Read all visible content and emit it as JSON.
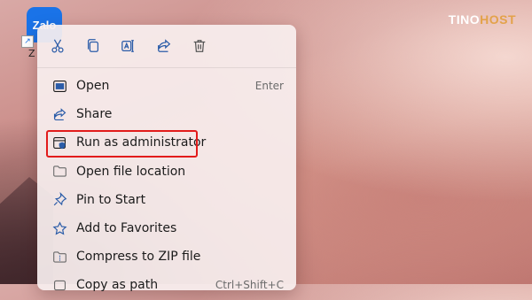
{
  "desktop": {
    "icon_text": "Zalo",
    "label": "Z"
  },
  "watermark": {
    "text_main": "TINO",
    "text_accent": "HOST"
  },
  "context_menu": {
    "toolbar": [
      {
        "name": "cut",
        "icon": "scissors-icon"
      },
      {
        "name": "copy",
        "icon": "copy-icon"
      },
      {
        "name": "rename",
        "icon": "rename-icon"
      },
      {
        "name": "share",
        "icon": "share-icon"
      },
      {
        "name": "delete",
        "icon": "trash-icon"
      }
    ],
    "items": [
      {
        "label": "Open",
        "shortcut": "Enter",
        "icon": "open-window-icon"
      },
      {
        "label": "Share",
        "shortcut": "",
        "icon": "share-icon"
      },
      {
        "label": "Run as administrator",
        "shortcut": "",
        "icon": "shield-window-icon"
      },
      {
        "label": "Open file location",
        "shortcut": "",
        "icon": "folder-icon"
      },
      {
        "label": "Pin to Start",
        "shortcut": "",
        "icon": "pin-icon"
      },
      {
        "label": "Add to Favorites",
        "shortcut": "",
        "icon": "star-icon"
      },
      {
        "label": "Compress to ZIP file",
        "shortcut": "",
        "icon": "zip-folder-icon"
      },
      {
        "label": "Copy as path",
        "shortcut": "Ctrl+Shift+C",
        "icon": "copy-path-icon"
      }
    ]
  },
  "colors": {
    "accent_icon": "#2b5ca8",
    "highlight_border": "#e21b1b",
    "watermark_accent": "#e3a24a"
  }
}
